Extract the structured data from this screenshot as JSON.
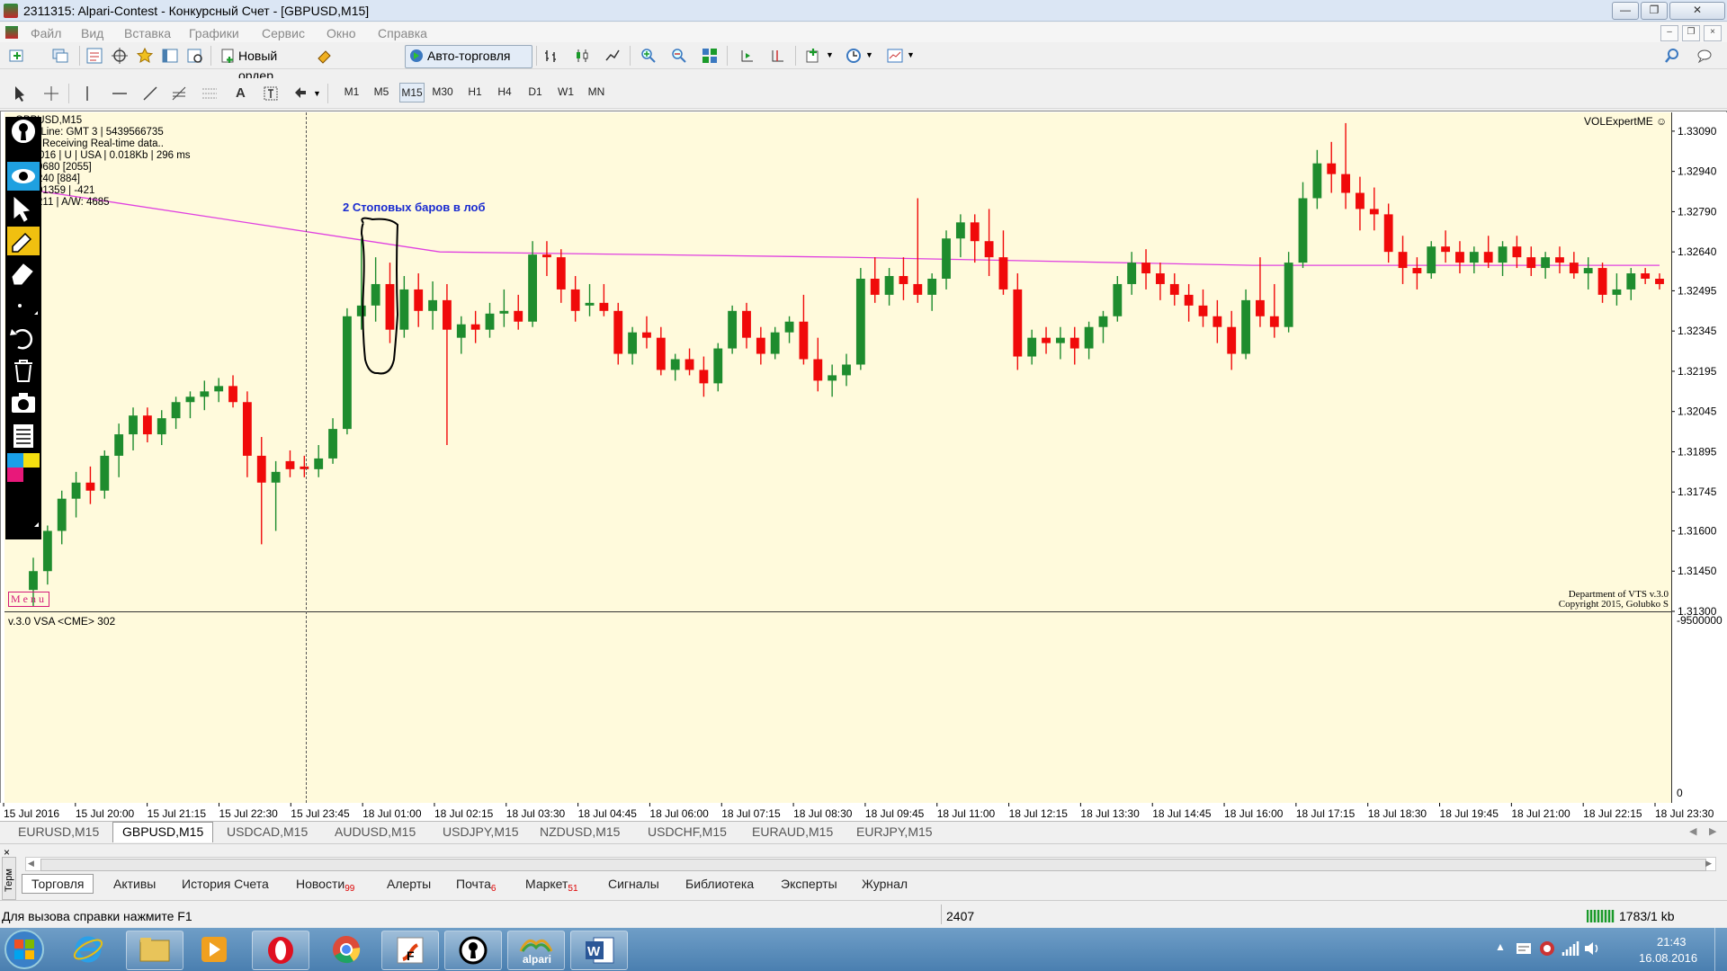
{
  "window": {
    "title": "2311315: Alpari-Contest - Конкурсный Счет - [GBPUSD,M15]"
  },
  "menu": [
    "Файл",
    "Вид",
    "Вставка",
    "Графики",
    "Сервис",
    "Окно",
    "Справка"
  ],
  "toolbar": {
    "new_order": "Новый ордер",
    "autotrade": "Авто-торговля"
  },
  "timeframes": [
    "M1",
    "M5",
    "M15",
    "M30",
    "H1",
    "H4",
    "D1",
    "W1",
    "MN"
  ],
  "active_timeframe": "M15",
  "chart": {
    "symbol": "GBPUSD,M15",
    "info_lines": [
      "GBPUSD,M15",
      "Time Line: GMT 3 | 5439566735",
      "ADS:  Receiving Real-time data..",
      "13/9/2016 | U | USA | 0.018Kb | 296 ms",
      "9680  [2055]",
      "240  [884]",
      "01359 | -421",
      "211 | A/W: 4685"
    ],
    "expert": "VOLExpertME ☺",
    "annotation": "2 Стоповых баров в лоб",
    "menu_label": "Menu",
    "credit": [
      "Department of VTS  v.3.0",
      "Copyright 2015, Golubko S"
    ],
    "indicator_label": "v.3.0 VSA <CME> 302",
    "indicator_scale_top": "-9500000",
    "indicator_scale_bottom": "0"
  },
  "chart_data": {
    "type": "candlestick",
    "symbol": "GBPUSD",
    "timeframe": "M15",
    "price_ticks": [
      1.3309,
      1.3294,
      1.3279,
      1.3264,
      1.32495,
      1.32345,
      1.32195,
      1.32045,
      1.31895,
      1.31745,
      1.316,
      1.3145,
      1.313
    ],
    "time_ticks": [
      "15 Jul 2016",
      "15 Jul 20:00",
      "15 Jul 21:15",
      "15 Jul 22:30",
      "15 Jul 23:45",
      "18 Jul 01:00",
      "18 Jul 02:15",
      "18 Jul 03:30",
      "18 Jul 04:45",
      "18 Jul 06:00",
      "18 Jul 07:15",
      "18 Jul 08:30",
      "18 Jul 09:45",
      "18 Jul 11:00",
      "18 Jul 12:15",
      "18 Jul 13:30",
      "18 Jul 14:45",
      "18 Jul 16:00",
      "18 Jul 17:15",
      "18 Jul 18:30",
      "18 Jul 19:45",
      "18 Jul 21:00",
      "18 Jul 22:15",
      "18 Jul 23:30"
    ],
    "ylim": [
      1.313,
      1.3316
    ],
    "candles": [
      [
        1.3138,
        1.315,
        1.3132,
        1.3145
      ],
      [
        1.3145,
        1.3162,
        1.314,
        1.316
      ],
      [
        1.316,
        1.3175,
        1.3155,
        1.3172
      ],
      [
        1.3172,
        1.3182,
        1.3165,
        1.3178
      ],
      [
        1.3178,
        1.3184,
        1.317,
        1.3175
      ],
      [
        1.3175,
        1.319,
        1.3172,
        1.3188
      ],
      [
        1.3188,
        1.32,
        1.318,
        1.3196
      ],
      [
        1.3196,
        1.3206,
        1.319,
        1.3203
      ],
      [
        1.3203,
        1.3206,
        1.3193,
        1.3196
      ],
      [
        1.3196,
        1.3205,
        1.3192,
        1.3202
      ],
      [
        1.3202,
        1.321,
        1.3198,
        1.3208
      ],
      [
        1.3208,
        1.3212,
        1.3202,
        1.321
      ],
      [
        1.321,
        1.3216,
        1.3205,
        1.3212
      ],
      [
        1.3212,
        1.3217,
        1.3208,
        1.3214
      ],
      [
        1.3214,
        1.3218,
        1.3206,
        1.3208
      ],
      [
        1.3208,
        1.3212,
        1.318,
        1.3188
      ],
      [
        1.3188,
        1.3195,
        1.3155,
        1.3178
      ],
      [
        1.3178,
        1.3186,
        1.316,
        1.3182
      ],
      [
        1.3186,
        1.319,
        1.318,
        1.3183
      ],
      [
        1.3184,
        1.3188,
        1.318,
        1.3183
      ],
      [
        1.3183,
        1.3192,
        1.318,
        1.3187
      ],
      [
        1.3187,
        1.3202,
        1.3185,
        1.3198
      ],
      [
        1.3198,
        1.3243,
        1.3196,
        1.324
      ],
      [
        1.324,
        1.3269,
        1.3235,
        1.3244
      ],
      [
        1.3244,
        1.3262,
        1.3238,
        1.3252
      ],
      [
        1.3252,
        1.326,
        1.323,
        1.3235
      ],
      [
        1.3235,
        1.3255,
        1.3232,
        1.325
      ],
      [
        1.325,
        1.3256,
        1.3236,
        1.3242
      ],
      [
        1.3242,
        1.3253,
        1.3235,
        1.3246
      ],
      [
        1.3246,
        1.3252,
        1.3192,
        1.3235
      ],
      [
        1.3232,
        1.324,
        1.3226,
        1.3237
      ],
      [
        1.3237,
        1.3242,
        1.323,
        1.3235
      ],
      [
        1.3235,
        1.3245,
        1.3232,
        1.3241
      ],
      [
        1.3241,
        1.325,
        1.3236,
        1.3242
      ],
      [
        1.3242,
        1.3248,
        1.3235,
        1.3238
      ],
      [
        1.3238,
        1.3268,
        1.3236,
        1.3263
      ],
      [
        1.3263,
        1.3268,
        1.3255,
        1.3262
      ],
      [
        1.3262,
        1.3265,
        1.3245,
        1.325
      ],
      [
        1.325,
        1.3255,
        1.3238,
        1.3242
      ],
      [
        1.3244,
        1.3252,
        1.324,
        1.3245
      ],
      [
        1.3245,
        1.3252,
        1.324,
        1.3242
      ],
      [
        1.3242,
        1.3245,
        1.3222,
        1.3226
      ],
      [
        1.3226,
        1.3236,
        1.3222,
        1.3234
      ],
      [
        1.3234,
        1.324,
        1.3228,
        1.3232
      ],
      [
        1.3232,
        1.3236,
        1.3218,
        1.322
      ],
      [
        1.322,
        1.3226,
        1.3216,
        1.3224
      ],
      [
        1.3224,
        1.3228,
        1.3218,
        1.322
      ],
      [
        1.322,
        1.3225,
        1.321,
        1.3215
      ],
      [
        1.3215,
        1.323,
        1.3212,
        1.3228
      ],
      [
        1.3228,
        1.3244,
        1.3226,
        1.3242
      ],
      [
        1.3242,
        1.3245,
        1.3228,
        1.3232
      ],
      [
        1.3232,
        1.3236,
        1.3222,
        1.3226
      ],
      [
        1.3226,
        1.3236,
        1.3224,
        1.3234
      ],
      [
        1.3234,
        1.324,
        1.323,
        1.3238
      ],
      [
        1.3238,
        1.3248,
        1.3222,
        1.3224
      ],
      [
        1.3224,
        1.3232,
        1.3212,
        1.3216
      ],
      [
        1.3216,
        1.3222,
        1.321,
        1.3218
      ],
      [
        1.3218,
        1.3226,
        1.3214,
        1.3222
      ],
      [
        1.3222,
        1.3258,
        1.322,
        1.3254
      ],
      [
        1.3254,
        1.3262,
        1.3245,
        1.3248
      ],
      [
        1.3248,
        1.3258,
        1.3244,
        1.3255
      ],
      [
        1.3255,
        1.3262,
        1.3246,
        1.3252
      ],
      [
        1.3252,
        1.3284,
        1.3245,
        1.3248
      ],
      [
        1.3248,
        1.3256,
        1.3242,
        1.3254
      ],
      [
        1.3254,
        1.3272,
        1.325,
        1.3269
      ],
      [
        1.3269,
        1.3278,
        1.3262,
        1.3275
      ],
      [
        1.3275,
        1.3278,
        1.326,
        1.3268
      ],
      [
        1.3268,
        1.328,
        1.3255,
        1.3262
      ],
      [
        1.3262,
        1.3272,
        1.3248,
        1.325
      ],
      [
        1.325,
        1.3256,
        1.322,
        1.3225
      ],
      [
        1.3225,
        1.3235,
        1.3222,
        1.3232
      ],
      [
        1.3232,
        1.3236,
        1.3226,
        1.323
      ],
      [
        1.323,
        1.3236,
        1.3224,
        1.3232
      ],
      [
        1.3232,
        1.3236,
        1.3222,
        1.3228
      ],
      [
        1.3228,
        1.3238,
        1.3224,
        1.3236
      ],
      [
        1.3236,
        1.3242,
        1.323,
        1.324
      ],
      [
        1.324,
        1.3255,
        1.3238,
        1.3252
      ],
      [
        1.3252,
        1.3264,
        1.3248,
        1.326
      ],
      [
        1.326,
        1.3265,
        1.325,
        1.3256
      ],
      [
        1.3256,
        1.326,
        1.3246,
        1.3252
      ],
      [
        1.3252,
        1.3256,
        1.3244,
        1.3248
      ],
      [
        1.3248,
        1.3252,
        1.3238,
        1.3244
      ],
      [
        1.3244,
        1.325,
        1.3236,
        1.324
      ],
      [
        1.324,
        1.3246,
        1.323,
        1.3236
      ],
      [
        1.3236,
        1.3242,
        1.322,
        1.3226
      ],
      [
        1.3226,
        1.325,
        1.3224,
        1.3246
      ],
      [
        1.3246,
        1.3262,
        1.3236,
        1.324
      ],
      [
        1.324,
        1.3252,
        1.3232,
        1.3236
      ],
      [
        1.3236,
        1.3264,
        1.3234,
        1.326
      ],
      [
        1.326,
        1.329,
        1.3258,
        1.3284
      ],
      [
        1.3284,
        1.3302,
        1.328,
        1.3297
      ],
      [
        1.3297,
        1.3305,
        1.3286,
        1.3293
      ],
      [
        1.3293,
        1.3312,
        1.328,
        1.3286
      ],
      [
        1.3286,
        1.3292,
        1.3272,
        1.328
      ],
      [
        1.328,
        1.3288,
        1.3272,
        1.3278
      ],
      [
        1.3278,
        1.3282,
        1.326,
        1.3264
      ],
      [
        1.3264,
        1.327,
        1.3252,
        1.3258
      ],
      [
        1.3258,
        1.3262,
        1.325,
        1.3256
      ],
      [
        1.3256,
        1.3268,
        1.3254,
        1.3266
      ],
      [
        1.3266,
        1.3272,
        1.326,
        1.3264
      ],
      [
        1.3264,
        1.3268,
        1.3256,
        1.326
      ],
      [
        1.326,
        1.3266,
        1.3256,
        1.3264
      ],
      [
        1.3264,
        1.327,
        1.3258,
        1.326
      ],
      [
        1.326,
        1.3268,
        1.3255,
        1.3266
      ],
      [
        1.3266,
        1.327,
        1.3258,
        1.3262
      ],
      [
        1.3262,
        1.3266,
        1.3255,
        1.3258
      ],
      [
        1.3258,
        1.3264,
        1.3254,
        1.3262
      ],
      [
        1.3262,
        1.3266,
        1.3256,
        1.326
      ],
      [
        1.326,
        1.3264,
        1.3254,
        1.3256
      ],
      [
        1.3256,
        1.3262,
        1.325,
        1.3258
      ],
      [
        1.3258,
        1.326,
        1.3245,
        1.3248
      ],
      [
        1.3248,
        1.3256,
        1.3244,
        1.325
      ],
      [
        1.325,
        1.3258,
        1.3246,
        1.3256
      ],
      [
        1.3256,
        1.3258,
        1.3252,
        1.3254
      ],
      [
        1.3254,
        1.3256,
        1.325,
        1.3252
      ]
    ],
    "ma_line": {
      "color": "#e040e0",
      "values": [
        1.3287,
        1.3264,
        1.3262,
        1.3259,
        1.3259
      ]
    },
    "marker_time": "15 Jul 23:45"
  },
  "symbol_tabs": [
    "EURUSD,M15",
    "GBPUSD,M15",
    "USDCAD,M15",
    "AUDUSD,M15",
    "USDJPY,M15",
    "NZDUSD,M15",
    "USDCHF,M15",
    "EURAUD,M15",
    "EURJPY,M15"
  ],
  "active_symbol_tab": "GBPUSD,M15",
  "terminal": {
    "side_label": "Терм",
    "tabs": [
      {
        "label": "Торговля",
        "badge": ""
      },
      {
        "label": "Активы",
        "badge": ""
      },
      {
        "label": "История Счета",
        "badge": ""
      },
      {
        "label": "Новости",
        "badge": "99"
      },
      {
        "label": "Алерты",
        "badge": ""
      },
      {
        "label": "Почта",
        "badge": "6"
      },
      {
        "label": "Маркет",
        "badge": "51"
      },
      {
        "label": "Сигналы",
        "badge": ""
      },
      {
        "label": "Библиотека",
        "badge": ""
      },
      {
        "label": "Эксперты",
        "badge": ""
      },
      {
        "label": "Журнал",
        "badge": ""
      }
    ]
  },
  "status": {
    "help": "Для вызова справки нажмите F1",
    "bars": "2407",
    "traffic": "1783/1 kb"
  },
  "taskbar": {
    "apps": [
      "start",
      "ie",
      "explorer",
      "media",
      "opera",
      "chrome",
      "flash",
      "vsa",
      "alpari",
      "word"
    ],
    "alpari_label": "alpari",
    "time": "21:43",
    "date": "16.08.2016"
  },
  "colors": {
    "bull": "#1e8c2e",
    "bear": "#f00a0a",
    "chart_bg": "#fffadc",
    "ma": "#e040e0"
  }
}
